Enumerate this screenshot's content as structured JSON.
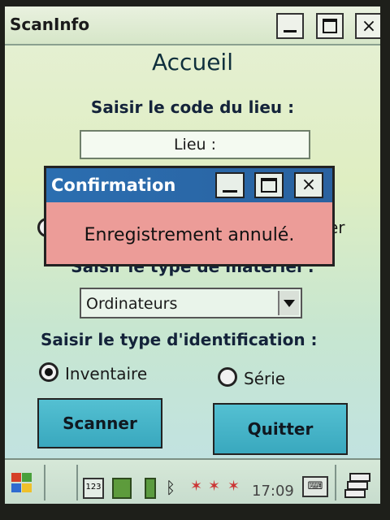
{
  "window": {
    "title": "ScanInfo",
    "close_glyph": "×"
  },
  "page": {
    "title": "Accueil",
    "lieu_label": "Saisir le code du lieu :",
    "lieu_placeholder": "Lieu :",
    "materiel_label": "Saisir le type de matériel :",
    "materiel_selected": "Ordinateurs",
    "identification_label": "Saisir le type d'identification :",
    "radio_inventaire": "Inventaire",
    "radio_serie": "Série",
    "partial_option_right": "er",
    "scan_button": "Scanner",
    "quit_button": "Quitter"
  },
  "dialog": {
    "title": "Confirmation",
    "message": "Enregistrement annulé.",
    "close_glyph": "×"
  },
  "taskbar": {
    "keyboard_icon_text": "123",
    "time": "17:09",
    "sip_icon_text": "⌨",
    "icons": [
      "windows-start-icon",
      "keyboard-123-icon",
      "memory-icon",
      "battery-icon",
      "bluetooth-icon",
      "network-icon",
      "network-icon",
      "sip-keyboard-icon",
      "task-switch-icon"
    ]
  }
}
